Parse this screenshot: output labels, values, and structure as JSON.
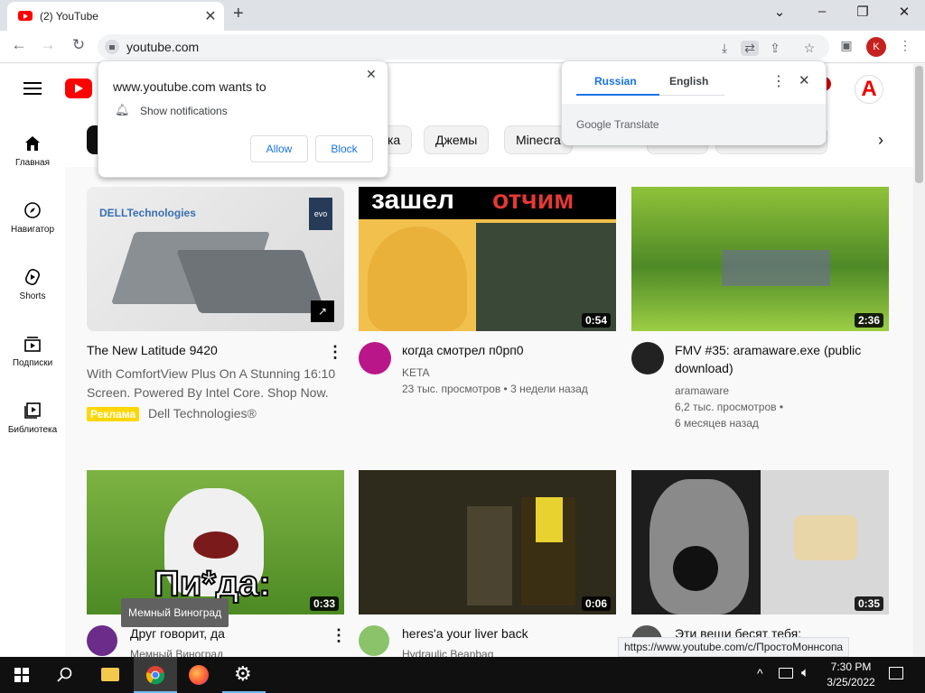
{
  "browser": {
    "tab_title": "(2) YouTube",
    "url": "youtube.com",
    "profile_initial": "K"
  },
  "notification_prompt": {
    "title": "www.youtube.com wants to",
    "item": "Show notifications",
    "allow": "Allow",
    "block": "Block"
  },
  "translate": {
    "lang_from": "Russian",
    "lang_to": "English",
    "brand": "Google",
    "brand_suffix": "Translate"
  },
  "header": {
    "avatar_letter": "A"
  },
  "sidebar": {
    "items": [
      {
        "label": "Главная"
      },
      {
        "label": "Навигатор"
      },
      {
        "label": "Shorts"
      },
      {
        "label": "Подписки"
      },
      {
        "label": "Библиотека"
      }
    ]
  },
  "chips": [
    "ка",
    "Джемы",
    "Minecra"
  ],
  "videos": [
    {
      "title": "The New Latitude 9420",
      "desc": "With ComfortView Plus On A Stunning 16:10 Screen. Powered By Intel Core. Shop Now.",
      "ad_badge": "Реклама",
      "channel": "Dell Technologies®",
      "thumb_text": "DELLTechnologies",
      "badge_text": "evo"
    },
    {
      "title": "когда смотрел п0рп0",
      "channel": "KETA",
      "meta": "23 тыс. просмотров • 3 недели назад",
      "duration": "0:54",
      "thumb_text_1": "зашел",
      "thumb_text_2": "отчим"
    },
    {
      "title": "FMV #35: aramaware.exe (public download)",
      "channel": "aramaware",
      "meta1": "6,2 тыс. просмотров •",
      "meta2": "6 месяцев назад",
      "duration": "2:36"
    },
    {
      "title": "Друг говорит, да",
      "channel": "Мемный Виноград",
      "duration": "0:33",
      "thumb_text": "Пи*да:"
    },
    {
      "title": "heres'a your liver back",
      "channel": "Hydraulic Beanbag",
      "duration": "0:06"
    },
    {
      "title": "Эти вещи бесят тебя:",
      "duration": "0:35"
    }
  ],
  "tooltip": "Мемный Виноград",
  "status_link": "https://www.youtube.com/c/ПростоМоннсопа",
  "taskbar": {
    "time": "7:30 PM",
    "date": "3/25/2022"
  },
  "colors": {
    "youtube_red": "#ff0000",
    "chrome_blue": "#1a73e8",
    "ad_yellow": "#ffd600"
  }
}
